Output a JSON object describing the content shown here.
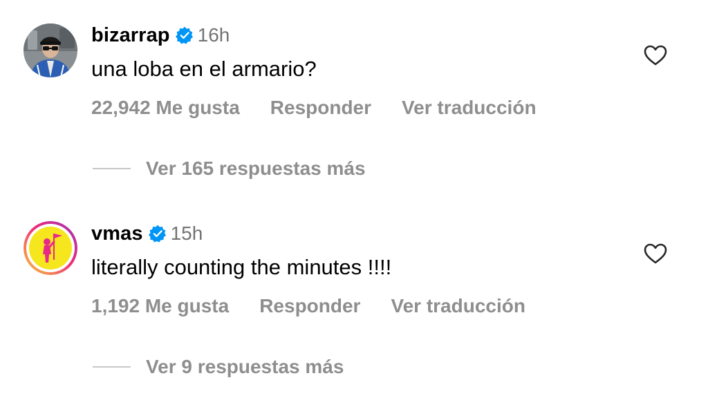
{
  "comments": [
    {
      "username": "bizarrap",
      "verified": true,
      "time": "16h",
      "text": "una loba en el armario?",
      "likes": "22,942 Me gusta",
      "reply": "Responder",
      "translate": "Ver traducción",
      "view_replies": "Ver 165 respuestas más",
      "avatar_icon": "user-avatar-photo"
    },
    {
      "username": "vmas",
      "verified": true,
      "time": "15h",
      "text": "literally counting the minutes !!!!",
      "likes": "1,192 Me gusta",
      "reply": "Responder",
      "translate": "Ver traducción",
      "view_replies": "Ver 9 respuestas más",
      "avatar_icon": "moonman-trophy-avatar"
    }
  ],
  "colors": {
    "verified_blue": "#0095f6",
    "secondary_text": "#737373",
    "action_text": "#8e8e8e",
    "story_ring_start": "#f9ce34",
    "story_ring_end": "#ee2a7b",
    "vmas_bg": "#f5e61e",
    "vmas_figure": "#e8298a"
  }
}
